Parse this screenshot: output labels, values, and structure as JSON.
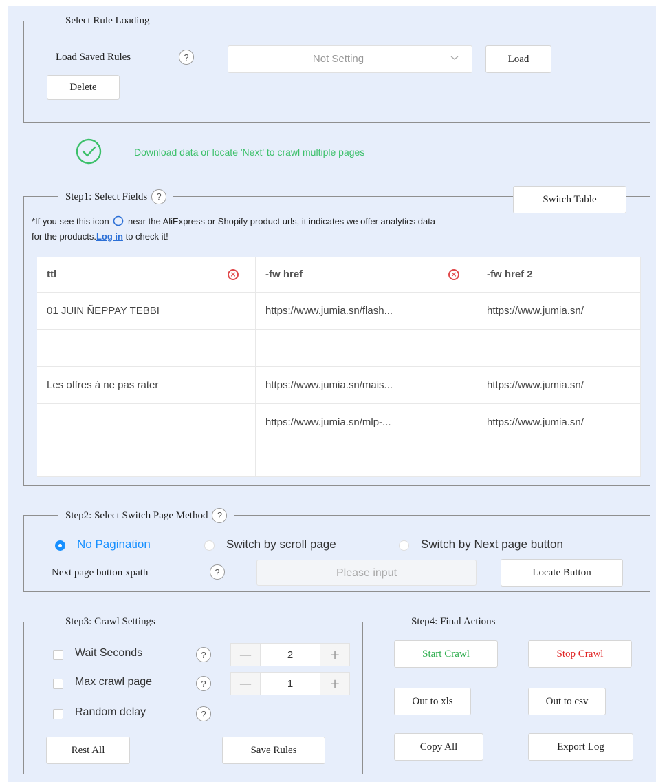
{
  "colors": {
    "panel_bg": "#e7eefb",
    "success_green": "#3cc06a",
    "link_blue": "#2b6fd6",
    "radio_blue": "#1890ff",
    "start_green": "#2fae4f",
    "stop_red": "#e02424"
  },
  "rule_loading": {
    "title": "Select Rule Loading",
    "load_saved_label": "Load Saved Rules",
    "help": "?",
    "select_value": "Not Setting",
    "load_label": "Load",
    "delete_label": "Delete"
  },
  "status": {
    "icon": "check-circle-icon",
    "message": "Download data or locate 'Next' to crawl multiple pages"
  },
  "step1": {
    "title": "Step1: Select Fields",
    "help": "?",
    "switch_table_label": "Switch Table",
    "notice_prefix": "*If you see this icon",
    "notice_suffix": "near the AliExpress or Shopify product urls, it indicates we offer analytics data",
    "notice_line2_text": "for the products.",
    "login_link": "Log in",
    "notice_line2_end": "to check it!",
    "columns": [
      "ttl",
      "-fw href",
      "-fw href 2"
    ],
    "rows": [
      [
        "01 JUIN ÑEPPAY TEBBI",
        "https://www.jumia.sn/flash...",
        "https://www.jumia.sn/"
      ],
      [
        "",
        "",
        ""
      ],
      [
        "Les offres à ne pas rater",
        "https://www.jumia.sn/mais...",
        "https://www.jumia.sn/"
      ],
      [
        "",
        "https://www.jumia.sn/mlp-...",
        "https://www.jumia.sn/"
      ],
      [
        "",
        "",
        ""
      ]
    ]
  },
  "step2": {
    "title": "Step2: Select Switch Page Method",
    "help": "?",
    "options": [
      "No Pagination",
      "Switch by scroll page",
      "Switch by Next page button"
    ],
    "selected_index": 0,
    "xpath_label": "Next page button xpath",
    "xpath_placeholder": "Please input",
    "locate_label": "Locate Button"
  },
  "step3": {
    "title": "Step3: Crawl Settings",
    "help": "?",
    "wait_label": "Wait Seconds",
    "wait_value": "2",
    "max_label": "Max crawl page",
    "max_value": "1",
    "random_label": "Random delay",
    "minus": "—",
    "plus": "+",
    "reset_label": "Rest All",
    "save_label": "Save Rules"
  },
  "step4": {
    "title": "Step4: Final Actions",
    "start_label": "Start Crawl",
    "stop_label": "Stop Crawl",
    "xls_label": "Out to xls",
    "csv_label": "Out to csv",
    "copy_label": "Copy All",
    "export_label": "Export Log"
  }
}
